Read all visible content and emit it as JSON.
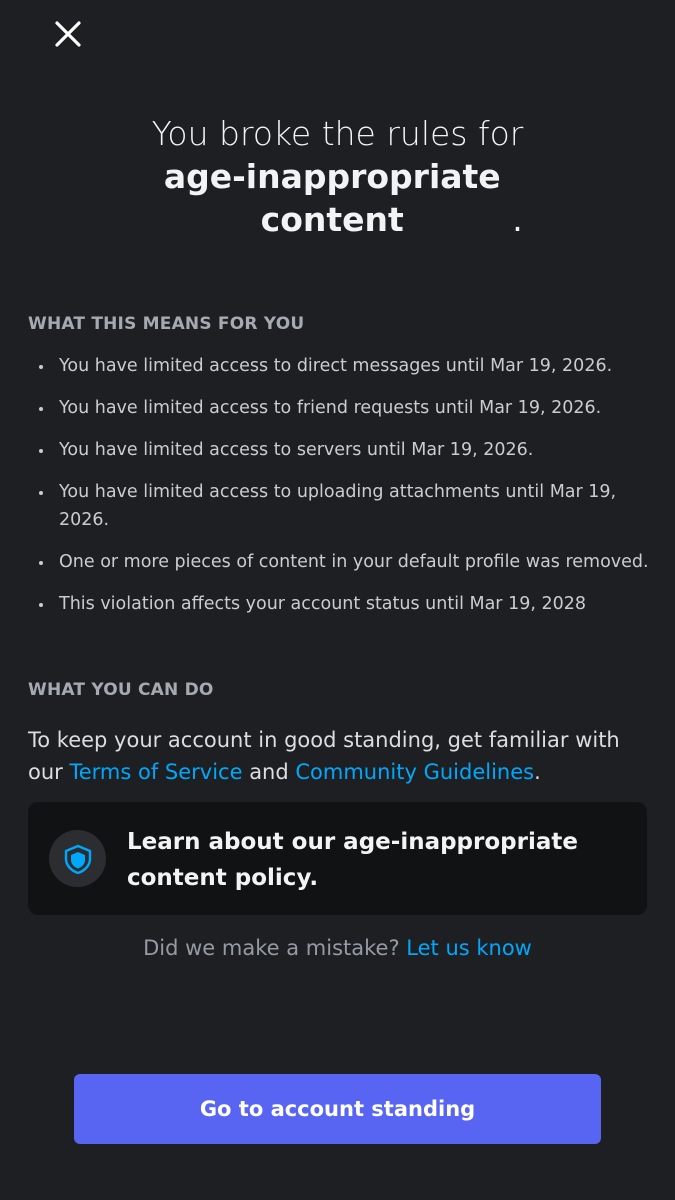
{
  "icons": {
    "close": "close-icon",
    "policy": "shield-icon"
  },
  "colors": {
    "background": "#1e1f22",
    "link": "#00a8fc",
    "button": "#5865f2",
    "card": "#111214"
  },
  "header": {
    "title_line1": "You broke the rules for",
    "title_bold": "age-inappropriate content",
    "title_period": "."
  },
  "means": {
    "heading": "WHAT THIS MEANS FOR YOU",
    "items": [
      "You have limited access to direct messages until Mar 19, 2026.",
      "You have limited access to friend requests until Mar 19, 2026.",
      "You have limited access to servers until Mar 19, 2026.",
      "You have limited access to uploading attachments until Mar 19, 2026.",
      "One or more pieces of content in your default profile was removed.",
      "This violation affects your account status until Mar 19, 2028"
    ]
  },
  "can_do": {
    "heading": "WHAT YOU CAN DO",
    "text_before": "To keep your account in good standing, get familiar with our ",
    "tos_link": "Terms of Service",
    "text_and": " and ",
    "guidelines_link": "Community Guidelines",
    "text_after": "."
  },
  "policy_card": {
    "label": "Learn about our age-inappropriate content policy."
  },
  "mistake": {
    "question": "Did we make a mistake? ",
    "link": "Let us know"
  },
  "footer": {
    "button_label": "Go to account standing"
  }
}
